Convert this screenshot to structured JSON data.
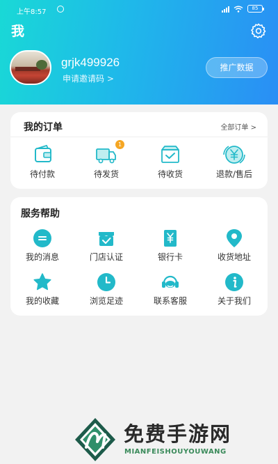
{
  "status_bar": {
    "time": "上午8:57",
    "battery": "85"
  },
  "page": {
    "title": "我"
  },
  "profile": {
    "username": "grjk499926",
    "invite_label": "申请邀请码 >",
    "promo_button": "推广数据"
  },
  "orders": {
    "title": "我的订单",
    "all_label": "全部订单 >",
    "items": [
      {
        "label": "待付款",
        "icon": "wallet-icon"
      },
      {
        "label": "待发货",
        "icon": "truck-icon",
        "badge": "1"
      },
      {
        "label": "待收货",
        "icon": "box-check-icon"
      },
      {
        "label": "退款/售后",
        "icon": "yuan-refund-icon"
      }
    ]
  },
  "services": {
    "title": "服务帮助",
    "items": [
      {
        "label": "我的消息",
        "icon": "message-icon"
      },
      {
        "label": "门店认证",
        "icon": "store-check-icon"
      },
      {
        "label": "银行卡",
        "icon": "bank-card-icon"
      },
      {
        "label": "收货地址",
        "icon": "location-pin-icon"
      },
      {
        "label": "我的收藏",
        "icon": "star-icon"
      },
      {
        "label": "浏览足迹",
        "icon": "clock-icon"
      },
      {
        "label": "联系客服",
        "icon": "headset-icon"
      },
      {
        "label": "关于我们",
        "icon": "info-icon"
      }
    ]
  },
  "watermark": {
    "title": "免费手游网",
    "subtitle": "MIANFEISHOUYOUWANG"
  },
  "colors": {
    "header_gradient_start": "#19d9d6",
    "header_gradient_end": "#2a8ef5",
    "icon_teal": "#22b9c9",
    "badge": "#f5a623"
  }
}
